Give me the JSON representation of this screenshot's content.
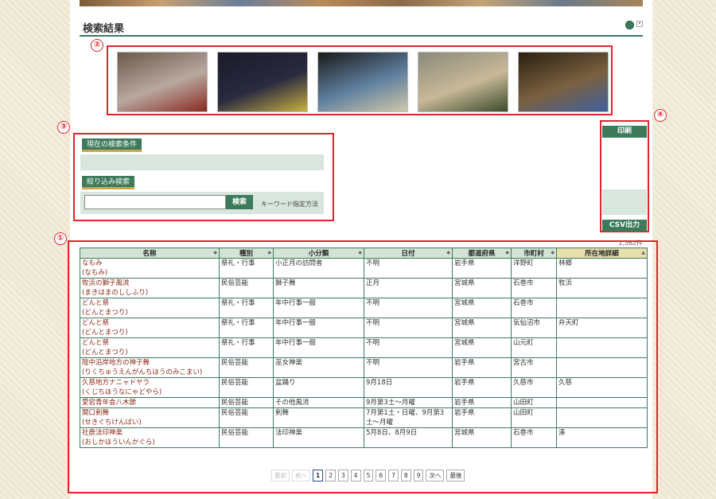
{
  "page": {
    "title": "検索結果"
  },
  "callouts": [
    "①",
    "②",
    "③",
    "④"
  ],
  "thumbnails": [
    {
      "alt": "photo-1",
      "c1": "#6b5848",
      "c2": "#b8a8a0",
      "c3": "#8a2a20"
    },
    {
      "alt": "photo-2",
      "c1": "#1a1a2a",
      "c2": "#2a2a40",
      "c3": "#c8b040"
    },
    {
      "alt": "photo-3",
      "c1": "#1a1a1a",
      "c2": "#6080a0",
      "c3": "#d0c8a8"
    },
    {
      "alt": "photo-4",
      "c1": "#8a8a7a",
      "c2": "#c8b898",
      "c3": "#3a4a2a"
    },
    {
      "alt": "photo-5",
      "c1": "#2a2010",
      "c2": "#7a6040",
      "c3": "#4060a0"
    }
  ],
  "conditions": {
    "current_label": "現在の検索条件",
    "refine_label": "絞り込み検索",
    "search_value": "",
    "search_placeholder": "",
    "search_button": "検索",
    "keyword_link": "キーワード指定方法"
  },
  "side": {
    "print_button": "印刷",
    "csv_button": "CSV出力"
  },
  "result_count": "1,362件",
  "table": {
    "headers": [
      "名称",
      "種別",
      "小分類",
      "日付",
      "都道府県",
      "市町村",
      "所在地詳細"
    ],
    "rows": [
      {
        "name1": "なもみ",
        "name2": "(なもみ)",
        "type": "祭礼・行事",
        "sub": "小正月の訪問者",
        "date": "不明",
        "pref": "岩手県",
        "city": "洋野町",
        "detail": "林郷"
      },
      {
        "name1": "牧浜の獅子風流",
        "name2": "(まきはまのししふり)",
        "type": "民俗芸能",
        "sub": "獅子舞",
        "date": "正月",
        "pref": "宮城県",
        "city": "石巻市",
        "detail": "牧浜"
      },
      {
        "name1": "どんと祭",
        "name2": "(どんとまつり)",
        "type": "祭礼・行事",
        "sub": "年中行事一般",
        "date": "不明",
        "pref": "宮城県",
        "city": "石巻市",
        "detail": ""
      },
      {
        "name1": "どんと祭",
        "name2": "(どんとまつり)",
        "type": "祭礼・行事",
        "sub": "年中行事一般",
        "date": "不明",
        "pref": "宮城県",
        "city": "気仙沼市",
        "detail": "弁天町"
      },
      {
        "name1": "どんと祭",
        "name2": "(どんとまつり)",
        "type": "祭礼・行事",
        "sub": "年中行事一般",
        "date": "不明",
        "pref": "宮城県",
        "city": "山元町",
        "detail": ""
      },
      {
        "name1": "陸中沿岸地方の神子舞",
        "name2": "(りくちゅうえんがんちほうのみこまい)",
        "type": "民俗芸能",
        "sub": "巫女神楽",
        "date": "不明",
        "pref": "岩手県",
        "city": "宮古市",
        "detail": ""
      },
      {
        "name1": "久慈地方ナニャドヤラ",
        "name2": "(くじちほうなにゃどやら)",
        "type": "民俗芸能",
        "sub": "盆踊り",
        "date": "9月18日",
        "pref": "岩手県",
        "city": "久慈市",
        "detail": "久慈"
      },
      {
        "name1": "愛宕青年会八木節",
        "name2": "",
        "type": "民俗芸能",
        "sub": "その他風流",
        "date": "9月第3土～月曜",
        "pref": "岩手県",
        "city": "山田町",
        "detail": ""
      },
      {
        "name1": "関口剣舞",
        "name2": "(せきぐちけんばい)",
        "type": "民俗芸能",
        "sub": "剣舞",
        "date": "7月第1土・日曜、9月第3土～月曜",
        "pref": "岩手県",
        "city": "山田町",
        "detail": ""
      },
      {
        "name1": "社鹿法印神楽",
        "name2": "(おしかほういんかぐら)",
        "type": "民俗芸能",
        "sub": "法印神楽",
        "date": "5月8日、8月9日",
        "pref": "宮城県",
        "city": "石巻市",
        "detail": "湊"
      }
    ]
  },
  "pager": {
    "first": "最初",
    "prev": "前へ",
    "pages": [
      "1",
      "2",
      "3",
      "4",
      "5",
      "6",
      "7",
      "8",
      "9"
    ],
    "next": "次へ",
    "last": "最後"
  },
  "colors": {
    "accent": "#3d7a5c",
    "callout_red": "#e0242c",
    "band": "#d8e6dd"
  }
}
